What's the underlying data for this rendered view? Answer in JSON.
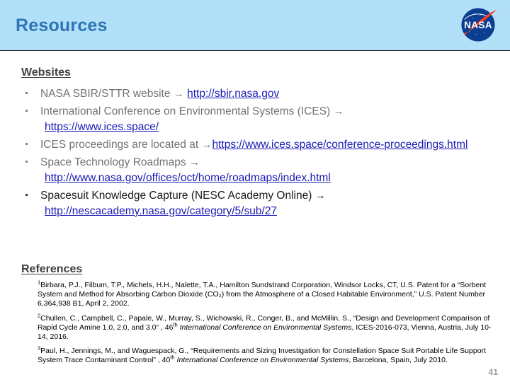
{
  "header": {
    "title": "Resources",
    "band_color": "#b3e0f9",
    "title_color": "#2e75b6",
    "logo": "nasa-meatball-logo"
  },
  "sections": {
    "websites": {
      "heading": "Websites",
      "bullets": [
        {
          "text": "NASA SBIR/STTR website ",
          "arrow": "→",
          "link": "http://sbir.nasa.gov",
          "link_on_new_line": false,
          "dark": false
        },
        {
          "text": "International Conference on Environmental Systems (ICES) ",
          "arrow": "→",
          "link": "https://www.ices.space/",
          "link_on_new_line": true,
          "dark": false
        },
        {
          "text": "ICES proceedings are located at ",
          "arrow": "→",
          "link": "https://www.ices.space/conference-proceedings.html",
          "link_on_new_line": false,
          "dark": false
        },
        {
          "text": "Space Technology Roadmaps ",
          "arrow": "→",
          "link": "http://www.nasa.gov/offices/oct/home/roadmaps/index.html",
          "link_on_new_line": true,
          "dark": false
        },
        {
          "text": "Spacesuit Knowledge Capture (NESC Academy Online) ",
          "arrow": "→",
          "link": "http://nescacademy.nasa.gov/category/5/sub/27",
          "link_on_new_line": true,
          "dark": true
        }
      ]
    },
    "references": {
      "heading": "References",
      "items": [
        {
          "marker": "1",
          "plain_1": "Birbara, P.J., Filbum, T.P., Michels, H.H., Nalette, T.A., Hamilton Sundstrand Corporation, Windsor Locks, CT, U.S. Patent for a  “Sorbent System and Method for Absorbing Carbon Dioxide (CO₂) from the Atmosphere of a Closed Habitable Environment,”  U.S. Patent Number 6,364,938 B1, April 2, 2002.",
          "italic": "",
          "plain_2": ""
        },
        {
          "marker": "2",
          "plain_1": "Chullen, C., Campbell, C.,  Papale, W.,  Murray, S., Wichowski, R., Conger, B., and McMillin, S.,  “Design and Development Comparison of Rapid Cycle Amine 1.0, 2.0, and 3.0” , 46",
          "superscript": "th",
          "italic": " International Conference on Environmental Systems",
          "plain_2": ", ICES-2016-073, Vienna, Austria, July 10-14, 2016."
        },
        {
          "marker": "3",
          "plain_1": "Paul, H., Jennings, M., and Waguespack, G.,  “Requirements and Sizing Investigation for Constellation Space Suit Portable Life Support System Trace Contaminant Control” , 40",
          "superscript": "th",
          "italic": " International Conference on Environmental Systems",
          "plain_2": ", Barcelona, Spain, July 2010."
        }
      ]
    }
  },
  "footer": {
    "page_number": "41"
  }
}
